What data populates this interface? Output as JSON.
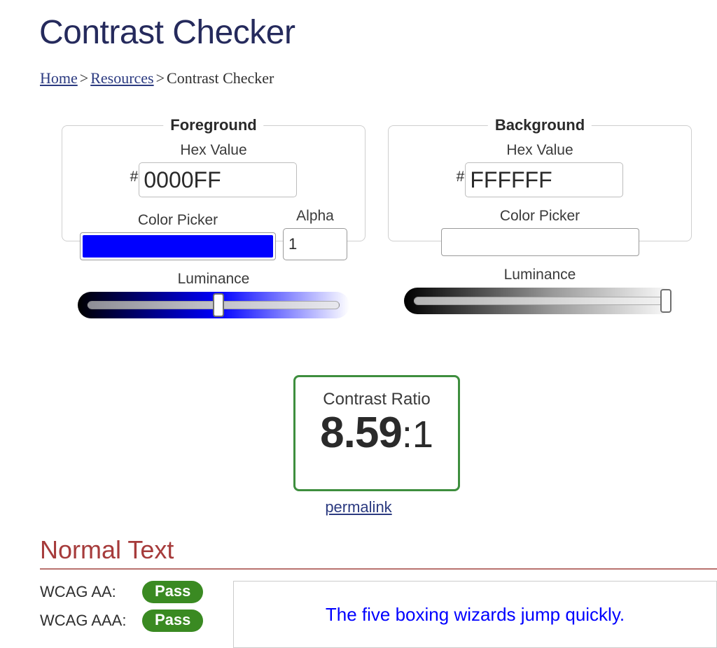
{
  "page": {
    "title": "Contrast Checker"
  },
  "breadcrumb": {
    "home": "Home",
    "sep1": ">",
    "resources": "Resources",
    "sep2": ">",
    "current": "Contrast Checker"
  },
  "foreground": {
    "legend": "Foreground",
    "hex_label": "Hex Value",
    "hash": "#",
    "hex_value": "0000FF",
    "picker_label": "Color Picker",
    "picker_color": "#0000FF",
    "alpha_label": "Alpha",
    "alpha_value": "1",
    "luminance_label": "Luminance",
    "luminance_percent": 52
  },
  "background": {
    "legend": "Background",
    "hex_label": "Hex Value",
    "hash": "#",
    "hex_value": "FFFFFF",
    "picker_label": "Color Picker",
    "picker_color": "#FFFFFF",
    "luminance_label": "Luminance",
    "luminance_percent": 100
  },
  "ratio": {
    "label": "Contrast Ratio",
    "value": "8.59",
    "suffix": ":1",
    "permalink": "permalink"
  },
  "normal_text": {
    "heading": "Normal Text",
    "rows": [
      {
        "label": "WCAG AA:",
        "status": "Pass"
      },
      {
        "label": "WCAG AAA:",
        "status": "Pass"
      }
    ],
    "sample": "The five boxing wizards jump quickly."
  },
  "colors": {
    "title": "#252a5c",
    "link": "#2b3a80",
    "pass_badge": "#3a8a22",
    "ratio_border": "#3e8e3e",
    "section_heading": "#a63b3b",
    "sample_text": "#0000FF"
  }
}
